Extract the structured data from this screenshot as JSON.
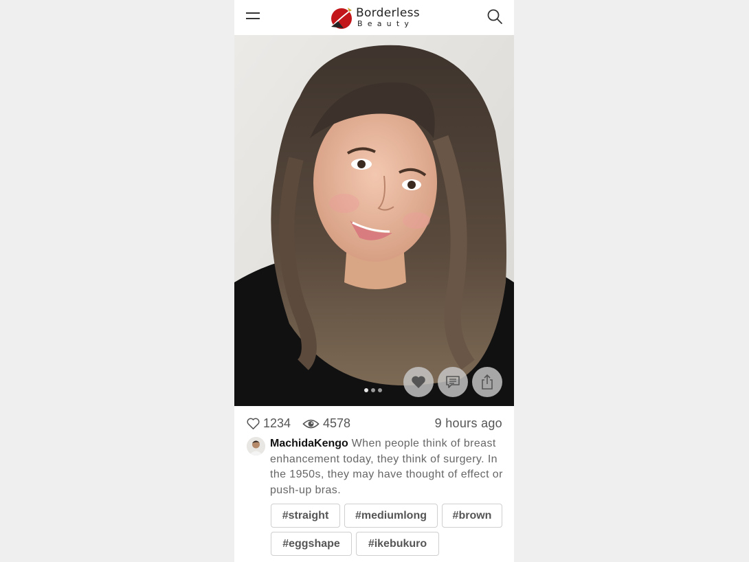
{
  "header": {
    "brand_line1": "Borderless",
    "brand_line2": "Beauty"
  },
  "carousel": {
    "total_images": 3,
    "active_index": 0
  },
  "stats": {
    "likes": "1234",
    "views": "4578",
    "posted": "9 hours ago"
  },
  "post": {
    "username": "MachidaKengo",
    "caption": "When people think of breast enhancement today, they think of surgery. In the 1950s, they may have thought of effect or push-up bras."
  },
  "tags": [
    "#straight",
    "#mediumlong",
    "#brown",
    "#eggshape",
    "#ikebukuro"
  ],
  "icons": {
    "menu": "hamburger-icon",
    "search": "search-icon",
    "like": "heart-icon",
    "comment": "comment-icon",
    "share": "share-icon",
    "views": "eye-icon"
  },
  "colors": {
    "brand_red": "#c2161b",
    "background": "#efefef",
    "text": "#555555"
  }
}
